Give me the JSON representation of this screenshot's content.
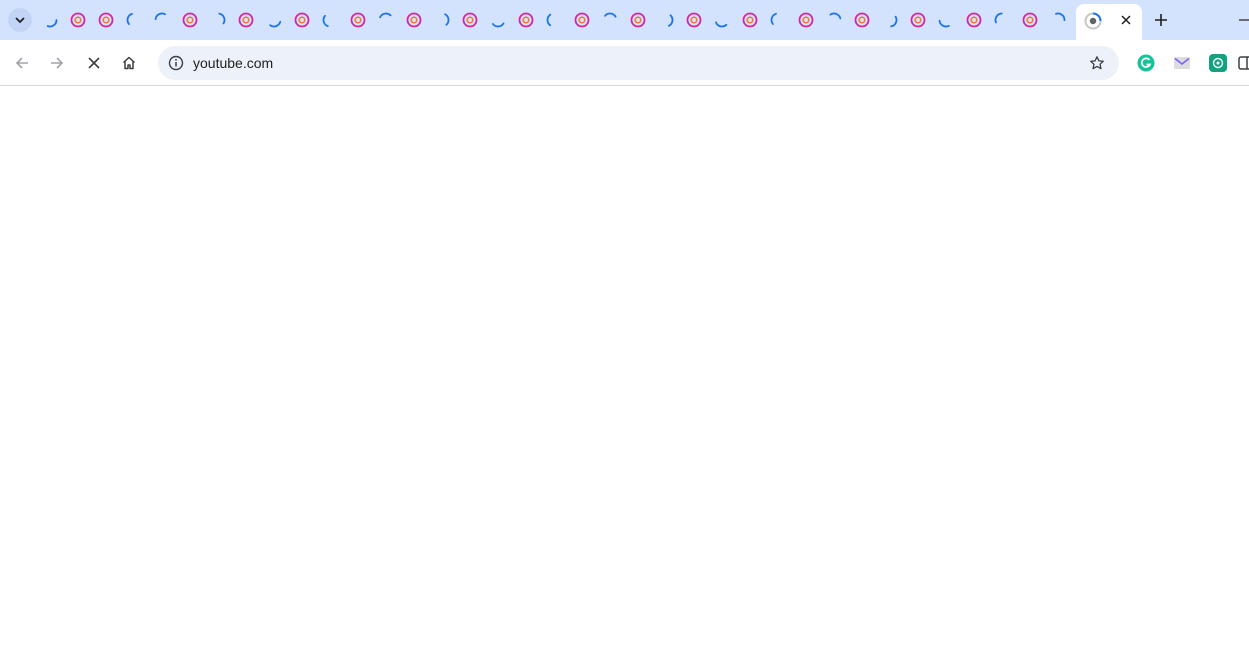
{
  "browser": {
    "address_bar": {
      "url": "youtube.com"
    },
    "tabs": [
      {
        "icon": "loading-spinner-icon"
      },
      {
        "icon": "instagram-icon"
      },
      {
        "icon": "instagram-icon"
      },
      {
        "icon": "loading-spinner-icon"
      },
      {
        "icon": "loading-spinner-icon"
      },
      {
        "icon": "instagram-icon"
      },
      {
        "icon": "loading-spinner-icon"
      },
      {
        "icon": "instagram-icon"
      },
      {
        "icon": "loading-spinner-icon"
      },
      {
        "icon": "instagram-icon"
      },
      {
        "icon": "loading-spinner-icon"
      },
      {
        "icon": "instagram-icon"
      },
      {
        "icon": "loading-spinner-icon"
      },
      {
        "icon": "instagram-icon"
      },
      {
        "icon": "loading-spinner-icon"
      },
      {
        "icon": "instagram-icon"
      },
      {
        "icon": "loading-spinner-icon"
      },
      {
        "icon": "instagram-icon"
      },
      {
        "icon": "loading-spinner-icon"
      },
      {
        "icon": "instagram-icon"
      },
      {
        "icon": "loading-spinner-icon"
      },
      {
        "icon": "instagram-icon"
      },
      {
        "icon": "loading-spinner-icon"
      },
      {
        "icon": "instagram-icon"
      },
      {
        "icon": "loading-spinner-icon"
      },
      {
        "icon": "instagram-icon"
      },
      {
        "icon": "loading-spinner-icon"
      },
      {
        "icon": "instagram-icon"
      },
      {
        "icon": "loading-spinner-icon"
      },
      {
        "icon": "instagram-icon"
      },
      {
        "icon": "loading-spinner-icon"
      },
      {
        "icon": "instagram-icon"
      },
      {
        "icon": "loading-spinner-icon"
      },
      {
        "icon": "instagram-icon"
      },
      {
        "icon": "loading-spinner-icon"
      },
      {
        "icon": "instagram-icon"
      },
      {
        "icon": "loading-spinner-icon"
      }
    ],
    "active_tab": {
      "icon": "google-icon",
      "status": "loading"
    },
    "extensions": [
      "grammarly-icon",
      "gmail-icon",
      "chatgpt-icon"
    ]
  },
  "colors": {
    "tabstrip_bg": "#d3e3fd",
    "omnibox_bg": "#edf2fa",
    "spinner_blue": "#1a73e8",
    "instagram_magenta": "#d6249f"
  }
}
